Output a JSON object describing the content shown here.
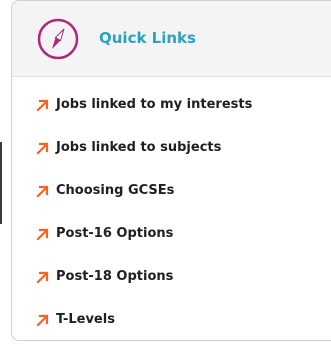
{
  "quick_links": {
    "title": "Quick Links",
    "header_icon": "compass-icon",
    "accent_color": "#2aa3bd",
    "icon_color": "#b0287a",
    "arrow_color": "#f26522",
    "items": [
      {
        "label": "Jobs linked to my interests",
        "icon": "arrow-up-right-icon"
      },
      {
        "label": "Jobs linked to subjects",
        "icon": "arrow-up-right-icon"
      },
      {
        "label": "Choosing GCSEs",
        "icon": "arrow-up-right-icon"
      },
      {
        "label": "Post-16 Options",
        "icon": "arrow-up-right-icon"
      },
      {
        "label": "Post-18 Options",
        "icon": "arrow-up-right-icon"
      },
      {
        "label": "T-Levels",
        "icon": "arrow-up-right-icon"
      }
    ]
  }
}
